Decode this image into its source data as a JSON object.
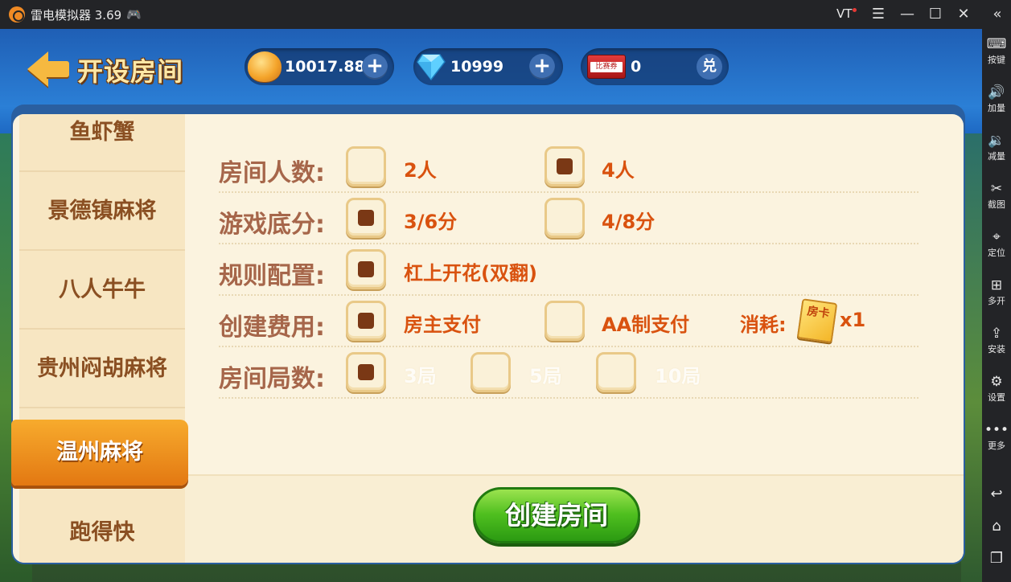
{
  "window": {
    "title": "雷电模拟器 3.69",
    "vt_label": "VT",
    "controls": {
      "menu": "☰",
      "minimize": "—",
      "maximize": "☐",
      "close": "✕",
      "collapse": "«"
    }
  },
  "sidebar": {
    "items": [
      {
        "icon": "keyboard-icon",
        "glyph": "⌨",
        "label": "按键"
      },
      {
        "icon": "volume-up-icon",
        "glyph": "🔊",
        "label": "加量"
      },
      {
        "icon": "volume-down-icon",
        "glyph": "🔉",
        "label": "减量"
      },
      {
        "icon": "scissors-icon",
        "glyph": "✂",
        "label": "截图"
      },
      {
        "icon": "location-icon",
        "glyph": "⌖",
        "label": "定位"
      },
      {
        "icon": "multi-open-icon",
        "glyph": "⊞",
        "label": "多开"
      },
      {
        "icon": "apk-install-icon",
        "glyph": "⇪",
        "label": "安装"
      },
      {
        "icon": "gear-icon",
        "glyph": "⚙",
        "label": "设置"
      },
      {
        "icon": "more-icon",
        "glyph": "•••",
        "label": "更多"
      }
    ],
    "nav": {
      "back": "↩",
      "home": "⌂",
      "recent": "❐"
    }
  },
  "header": {
    "title": "开设房间",
    "gold": "10017.88",
    "diamonds": "10999",
    "tickets": "0",
    "ticket_label": "比赛券",
    "redeem_label": "兑",
    "plus": "+"
  },
  "tabs": {
    "items": [
      "鱼虾蟹",
      "景德镇麻将",
      "八人牛牛",
      "贵州闷胡麻将",
      "温州麻将",
      "跑得快"
    ],
    "active_index": 4
  },
  "options": {
    "players": {
      "label": "房间人数:",
      "choices": [
        "2人",
        "4人"
      ],
      "selected": "4人"
    },
    "base_score": {
      "label": "游戏底分:",
      "choices": [
        "3/6分",
        "4/8分"
      ],
      "selected": "3/6分"
    },
    "rules": {
      "label": "规则配置:",
      "choices": [
        "杠上开花(双翻)"
      ],
      "selected": "杠上开花(双翻)"
    },
    "fee": {
      "label": "创建费用:",
      "choices": [
        "房主支付",
        "AA制支付"
      ],
      "selected": "房主支付",
      "cost_label": "消耗:",
      "card_text": "房卡",
      "cost_multiplier": "x1"
    },
    "rounds": {
      "label": "房间局数:",
      "choices": [
        "3局",
        "5局",
        "10局"
      ],
      "selected": "3局"
    }
  },
  "actions": {
    "create_room": "创建房间"
  },
  "colors": {
    "accent_orange": "#e37812",
    "option_text": "#d9520f",
    "label_brown": "#a6664a",
    "create_green": "#4fbf1f"
  }
}
